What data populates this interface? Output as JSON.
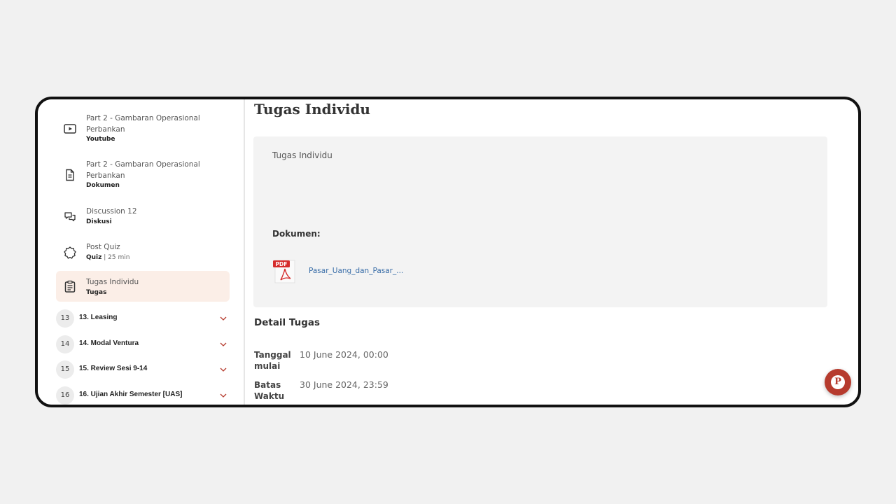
{
  "sidebar": {
    "items": [
      {
        "title": "Part 2 - Gambaran Operasional Perbankan",
        "type": "Youtube",
        "icon": "video-play-icon"
      },
      {
        "title": "Part 2 - Gambaran Operasional Perbankan",
        "type": "Dokumen",
        "icon": "document-icon"
      },
      {
        "title": "Discussion 12",
        "type": "Diskusi",
        "icon": "discussion-icon"
      },
      {
        "title": "Post Quiz",
        "type": "Quiz",
        "duration": " | 25 min",
        "icon": "quiz-badge-icon"
      },
      {
        "title": "Tugas Individu",
        "type": "Tugas",
        "icon": "clipboard-icon",
        "active": true
      }
    ],
    "sections": [
      {
        "number": "13",
        "title": "13. Leasing"
      },
      {
        "number": "14",
        "title": "14. Modal Ventura"
      },
      {
        "number": "15",
        "title": "15. Review Sesi 9-14"
      },
      {
        "number": "16",
        "title": "16. Ujian Akhir Semester [UAS]"
      }
    ]
  },
  "main": {
    "title": "Tugas Individu",
    "description": "Tugas Individu",
    "documents_label": "Dokumen:",
    "document": {
      "badge": "PDF",
      "filename": "Pasar_Uang_dan_Pasar_..."
    },
    "detail_title": "Detail Tugas",
    "details": [
      {
        "label": "Tanggal mulai",
        "value": "10 June 2024, 00:00"
      },
      {
        "label": "Batas Waktu",
        "value": "30 June 2024, 23:59"
      }
    ]
  },
  "fab": {
    "letter": "P"
  },
  "colors": {
    "accent": "#b63b2e",
    "active_bg": "#fbeee7",
    "link": "#3a6ea8"
  }
}
